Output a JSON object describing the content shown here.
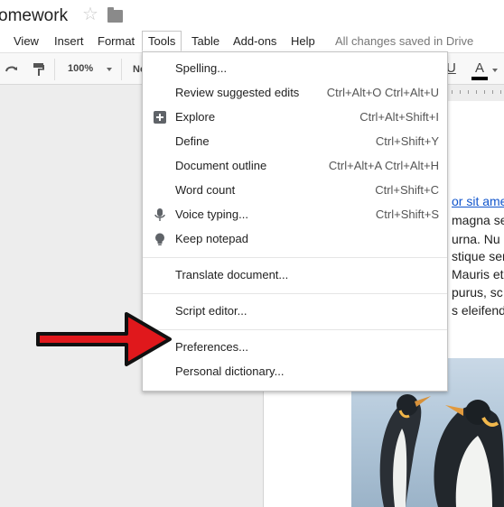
{
  "title_bar": {
    "doc_title": "omework",
    "star_icon": "star-outline",
    "folder_icon": "folder"
  },
  "menubar": {
    "items": [
      "View",
      "Insert",
      "Format",
      "Tools",
      "Table",
      "Add-ons",
      "Help"
    ],
    "active": "Tools",
    "save_status": "All changes saved in Drive"
  },
  "toolbar": {
    "zoom": "100%",
    "style_partial": "No",
    "underline": "U",
    "text_color_letter": "A",
    "text_color": "#000000"
  },
  "document": {
    "lines": [
      {
        "text": "or sit ame",
        "link": true
      },
      {
        "text": "magna se",
        "link": false
      },
      {
        "text": "urna. Nu",
        "link": false
      },
      {
        "text": "stique ser",
        "link": false
      },
      {
        "text": "Mauris et",
        "link": false
      },
      {
        "text": "purus, sc",
        "link": false
      },
      {
        "text": "s eleifend.",
        "link": false
      }
    ]
  },
  "tools_menu": {
    "items": [
      {
        "label": "Spelling...",
        "shortcut": "",
        "icon": ""
      },
      {
        "label": "Review suggested edits",
        "shortcut": "Ctrl+Alt+O Ctrl+Alt+U",
        "icon": ""
      },
      {
        "label": "Explore",
        "shortcut": "Ctrl+Alt+Shift+I",
        "icon": "explore-icon"
      },
      {
        "label": "Define",
        "shortcut": "Ctrl+Shift+Y",
        "icon": ""
      },
      {
        "label": "Document outline",
        "shortcut": "Ctrl+Alt+A Ctrl+Alt+H",
        "icon": ""
      },
      {
        "label": "Word count",
        "shortcut": "Ctrl+Shift+C",
        "icon": ""
      },
      {
        "label": "Voice typing...",
        "shortcut": "Ctrl+Shift+S",
        "icon": "microphone-icon"
      },
      {
        "label": "Keep notepad",
        "shortcut": "",
        "icon": "lightbulb-icon"
      },
      {
        "label": "Translate document...",
        "shortcut": "",
        "icon": ""
      },
      {
        "label": "Script editor...",
        "shortcut": "",
        "icon": ""
      },
      {
        "label": "Preferences...",
        "shortcut": "",
        "icon": ""
      },
      {
        "label": "Personal dictionary...",
        "shortcut": "",
        "icon": ""
      }
    ]
  },
  "annotation": {
    "arrow_color": "#e0181c",
    "points_to": "Preferences..."
  }
}
